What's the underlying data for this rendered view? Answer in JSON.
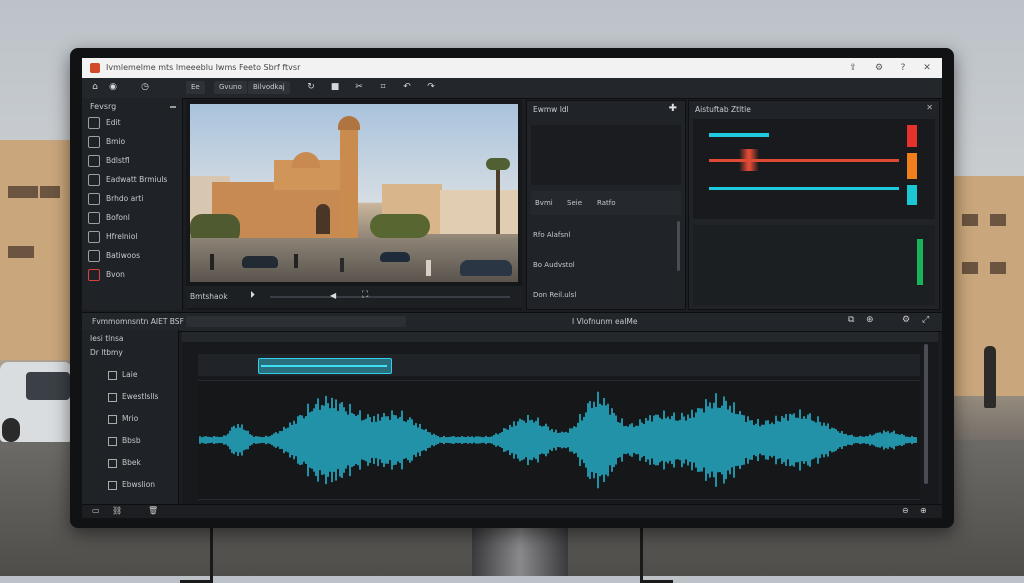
{
  "window": {
    "title": "Ivmlemelme mts lmeeeblu Iwms Feeto Sbrf ftvsr"
  },
  "toolbar": {
    "buttons": [
      "Ee",
      "Gvuno",
      "Bilvodkaj"
    ],
    "icons": [
      "rotate-icon",
      "stop-icon",
      "split-icon",
      "crop-icon",
      "undo-icon",
      "redo-icon"
    ]
  },
  "sidebar": {
    "heading": "Fevsrg",
    "items": [
      "Edit",
      "Bmio",
      "Bdlstfl",
      "Eadwatt Brmiuls",
      "Brhdo arti",
      "Bofonl",
      "Hfrelniol",
      "Batiwoos",
      "Bvon"
    ],
    "colors": [
      "#9aa0a6",
      "#9aa0a6",
      "#9aa0a6",
      "#9aa0a6",
      "#9aa0a6",
      "#9aa0a6",
      "#9aa0a6",
      "#9aa0a6",
      "#d9403a"
    ]
  },
  "viewer": {
    "timecode": "Bmtshaok"
  },
  "effects_panel": {
    "title": "Ewmw Idl",
    "tabs": [
      "Bvmi",
      "Seie",
      "Ratfo"
    ],
    "rows": [
      "Rfo Alafsnl",
      "Bo Audvstol",
      "Don Reil.ulsl"
    ]
  },
  "mixer_panel": {
    "title": "Aistuftab Ztltle",
    "bars": [
      {
        "color": "#e5322d"
      },
      {
        "color": "#f07f1b"
      },
      {
        "color": "#1cc7d4"
      }
    ],
    "meter_color": "#17b45a"
  },
  "timeline": {
    "label": "Fvmmomnsntn AIET BSF",
    "center_label": "I Vlofnunm eaIMe",
    "tracks_heading": "Iesi tlnsa",
    "tracks_sub": "Dr ltbmy",
    "track_items": [
      "Laie",
      "Ewestlslls",
      "Mrio",
      "Bbsb",
      "Bbek",
      "Ebwslion"
    ]
  },
  "colors": {
    "accent": "#29c8e6",
    "clip": "#30d0ea"
  }
}
